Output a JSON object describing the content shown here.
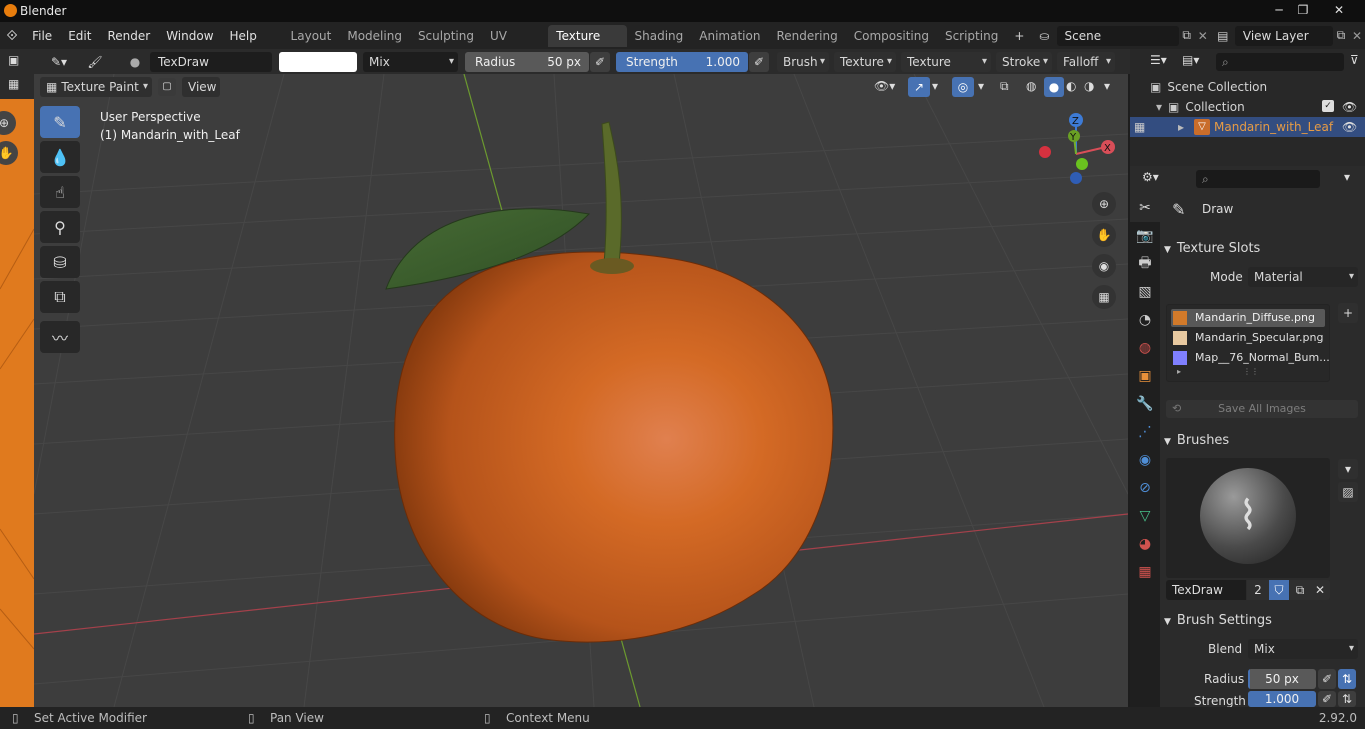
{
  "window": {
    "title": "Blender",
    "min": "─",
    "max": "❐",
    "close": "✕"
  },
  "menus": [
    "File",
    "Edit",
    "Render",
    "Window",
    "Help"
  ],
  "workspaces": [
    "Layout",
    "Modeling",
    "Sculpting",
    "UV Editing",
    "Texture Paint",
    "Shading",
    "Animation",
    "Rendering",
    "Compositing",
    "Scripting"
  ],
  "workspace_active": "Texture Paint",
  "add_tab": "+",
  "scene": {
    "name": "Scene"
  },
  "view_layer": {
    "name": "View Layer"
  },
  "tool_header": {
    "brush_name": "TexDraw",
    "blend": "Mix",
    "radius_label": "Radius",
    "radius_value": "50 px",
    "strength_label": "Strength",
    "strength_value": "1.000",
    "strength_level": 1.0,
    "radius_level": 0.5,
    "menus": [
      "Brush",
      "Texture",
      "Texture Mask",
      "Stroke",
      "Falloff"
    ]
  },
  "viewport_header": {
    "mode": "Texture Paint",
    "view": "View"
  },
  "viewport": {
    "overlay_line1": "User Perspective",
    "overlay_line2": "(1) Mandarin_with_Leaf",
    "gizmo": {
      "z": "Z",
      "y": "Y",
      "x": "X"
    }
  },
  "outliner": {
    "scene_collection": "Scene Collection",
    "collection": "Collection",
    "object": "Mandarin_with_Leaf"
  },
  "properties": {
    "tool_name": "Draw",
    "texture_slots_title": "Texture Slots",
    "mode_label": "Mode",
    "mode_value": "Material",
    "slots": [
      "Mandarin_Diffuse.png",
      "Mandarin_Specular.png",
      "Map__76_Normal_Bum..."
    ],
    "save_all": "Save All Images",
    "brushes_title": "Brushes",
    "brush_name": "TexDraw",
    "brush_users": "2",
    "brush_settings_title": "Brush Settings",
    "blend_label": "Blend",
    "blend_value": "Mix",
    "radius_label": "Radius",
    "radius_value": "50 px",
    "strength_label": "Strength",
    "strength_value": "1.000"
  },
  "statusbar": {
    "left": "Set Active Modifier",
    "middle": "Pan View",
    "right": "Context Menu",
    "version": "2.92.0"
  },
  "colors": {
    "accent": "#4772b3",
    "selected_object": "#e69b45",
    "orange": "#d65a12"
  }
}
